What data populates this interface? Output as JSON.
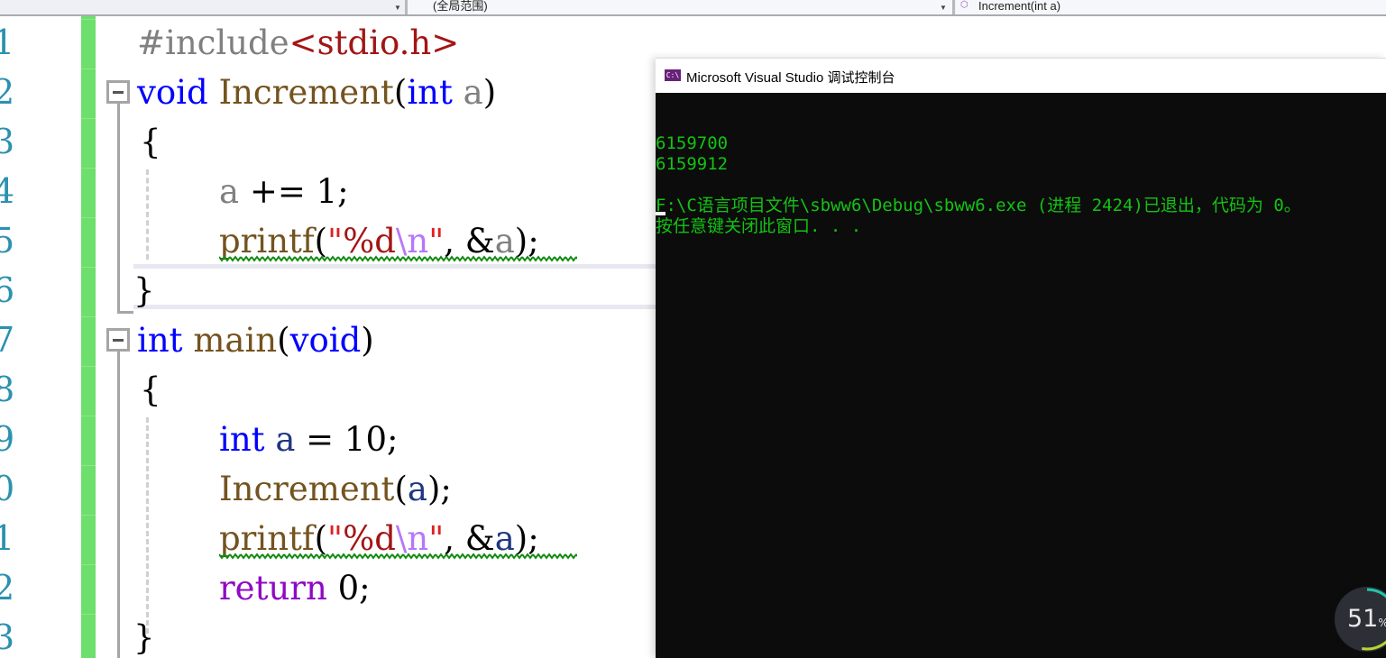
{
  "navbar": {
    "project_dropdown": "",
    "scope_dropdown": "(全局范围)",
    "function_dropdown": "Increment(int a)",
    "function_icon": "method-cube-icon"
  },
  "editor": {
    "line_numbers": [
      "1",
      "2",
      "3",
      "4",
      "5",
      "6",
      "7",
      "8",
      "9",
      "0",
      "1",
      "2",
      "3"
    ],
    "lines": [
      {
        "segments": [
          {
            "t": "#include",
            "c": "pre"
          },
          {
            "t": "<stdio.h>",
            "c": "str"
          }
        ]
      },
      {
        "segments": [
          {
            "t": "void",
            "c": "kw"
          },
          {
            "t": " "
          },
          {
            "t": "Increment",
            "c": "fn"
          },
          {
            "t": "("
          },
          {
            "t": "int",
            "c": "kw"
          },
          {
            "t": " "
          },
          {
            "t": "a",
            "c": "param"
          },
          {
            "t": ")"
          }
        ]
      },
      {
        "segments": [
          {
            "t": "{"
          }
        ]
      },
      {
        "segments": [
          {
            "t": "a",
            "c": "param"
          },
          {
            "t": " += 1;"
          }
        ]
      },
      {
        "segments": [
          {
            "t": "printf",
            "c": "fn"
          },
          {
            "t": "("
          },
          {
            "t": "\"",
            "c": "quote"
          },
          {
            "t": "%d",
            "c": "str"
          },
          {
            "t": "\\n",
            "c": "esc"
          },
          {
            "t": "\"",
            "c": "quote"
          },
          {
            "t": ", &"
          },
          {
            "t": "a",
            "c": "param"
          },
          {
            "t": ");"
          }
        ]
      },
      {
        "segments": [
          {
            "t": "}"
          }
        ]
      },
      {
        "segments": [
          {
            "t": "int",
            "c": "kw"
          },
          {
            "t": " "
          },
          {
            "t": "main",
            "c": "fn"
          },
          {
            "t": "("
          },
          {
            "t": "void",
            "c": "kw"
          },
          {
            "t": ")"
          }
        ]
      },
      {
        "segments": [
          {
            "t": "{"
          }
        ]
      },
      {
        "segments": [
          {
            "t": "int",
            "c": "kw"
          },
          {
            "t": " "
          },
          {
            "t": "a",
            "c": "var"
          },
          {
            "t": " = 10;"
          }
        ]
      },
      {
        "segments": [
          {
            "t": "Increment",
            "c": "fn"
          },
          {
            "t": "("
          },
          {
            "t": "a",
            "c": "var"
          },
          {
            "t": ");"
          }
        ]
      },
      {
        "segments": [
          {
            "t": "printf",
            "c": "fn"
          },
          {
            "t": "("
          },
          {
            "t": "\"",
            "c": "quote"
          },
          {
            "t": "%d",
            "c": "str"
          },
          {
            "t": "\\n",
            "c": "esc"
          },
          {
            "t": "\"",
            "c": "quote"
          },
          {
            "t": ", &"
          },
          {
            "t": "a",
            "c": "var"
          },
          {
            "t": ");"
          }
        ]
      },
      {
        "segments": [
          {
            "t": "return",
            "c": "ret"
          },
          {
            "t": " 0;"
          }
        ]
      },
      {
        "segments": [
          {
            "t": "}"
          }
        ]
      }
    ],
    "warnings": [
      "printf(\"%d\\n\", &a) — line 5",
      "printf(\"%d\\n\", &a) — line 11"
    ]
  },
  "console": {
    "title": "Microsoft Visual Studio 调试控制台",
    "icon_label": "C:\\",
    "output_lines": [
      "6159700",
      "6159912",
      "",
      "F:\\C语言项目文件\\sbww6\\Debug\\sbww6.exe (进程 2424)已退出，代码为 0。",
      "按任意键关闭此窗口. . ."
    ],
    "text_color": "#13c313",
    "background": "#0c0c0c"
  },
  "perf_widget": {
    "value": "51",
    "unit": "%",
    "fraction": 0.51
  }
}
